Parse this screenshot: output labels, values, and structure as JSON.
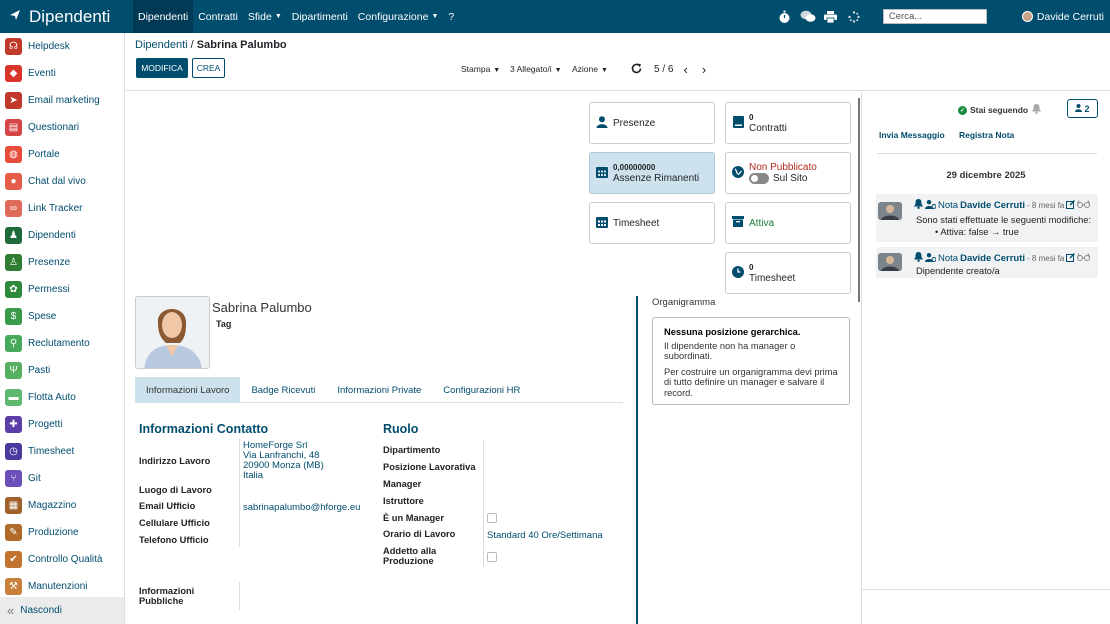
{
  "topbar": {
    "app_title": "Dipendenti",
    "menu": [
      {
        "label": "Dipendenti",
        "active": true
      },
      {
        "label": "Contratti",
        "active": false
      },
      {
        "label": "Sfide",
        "active": false,
        "caret": true
      },
      {
        "label": "Dipartimenti",
        "active": false
      },
      {
        "label": "Configurazione",
        "active": false,
        "caret": true
      },
      {
        "label": "?",
        "active": false
      }
    ],
    "search_placeholder": "Cerca...",
    "user_name": "Davide Cerruti"
  },
  "sidebar": {
    "items": [
      {
        "label": "Helpdesk",
        "color": "#c0392b",
        "icon": "headset-icon"
      },
      {
        "label": "Eventi",
        "color": "#d9352b",
        "icon": "ticket-icon"
      },
      {
        "label": "Email marketing",
        "color": "#c0392b",
        "icon": "paper-plane-icon"
      },
      {
        "label": "Questionari",
        "color": "#d64545",
        "icon": "clipboard-icon"
      },
      {
        "label": "Portale",
        "color": "#e74c3c",
        "icon": "globe-icon"
      },
      {
        "label": "Chat dal vivo",
        "color": "#e85d4a",
        "icon": "chat-icon"
      },
      {
        "label": "Link Tracker",
        "color": "#e06a5a",
        "icon": "link-icon"
      },
      {
        "label": "Dipendenti",
        "color": "#1e6a3a",
        "icon": "users-icon"
      },
      {
        "label": "Presenze",
        "color": "#2e7d32",
        "icon": "user-check-icon"
      },
      {
        "label": "Permessi",
        "color": "#2e8b3e",
        "icon": "leaf-icon"
      },
      {
        "label": "Spese",
        "color": "#3a9a4a",
        "icon": "dollar-icon"
      },
      {
        "label": "Reclutamento",
        "color": "#46a85a",
        "icon": "search-user-icon"
      },
      {
        "label": "Pasti",
        "color": "#55b060",
        "icon": "utensils-icon"
      },
      {
        "label": "Flotta Auto",
        "color": "#5fb870",
        "icon": "car-icon"
      },
      {
        "label": "Progetti",
        "color": "#5b3ea8",
        "icon": "puzzle-icon"
      },
      {
        "label": "Timesheet",
        "color": "#4a3aa0",
        "icon": "clock-icon"
      },
      {
        "label": "Git",
        "color": "#6a4fb8",
        "icon": "git-icon"
      },
      {
        "label": "Magazzino",
        "color": "#a0612a",
        "icon": "cubes-icon"
      },
      {
        "label": "Produzione",
        "color": "#b06a2a",
        "icon": "wrench-icon"
      },
      {
        "label": "Controllo Qualità",
        "color": "#c07430",
        "icon": "check-icon"
      },
      {
        "label": "Manutenzioni",
        "color": "#c8803a",
        "icon": "hammer-icon"
      }
    ],
    "hide_label": "Nascondi"
  },
  "breadcrumb": {
    "parent": "Dipendenti",
    "separator": "/",
    "current": "Sabrina Palumbo"
  },
  "toolbar": {
    "edit_label": "MODIFICA",
    "create_label": "CREA",
    "print_label": "Stampa",
    "attachments_label": "3 Allegato/i",
    "action_label": "Azione",
    "pager": "5 / 6"
  },
  "smart_buttons": {
    "presenze": "Presenze",
    "contratti_count": "0",
    "contratti": "Contratti",
    "assenze_value": "0,00000000",
    "assenze": "Assenze Rimanenti",
    "pubblicato": "Non Pubblicato",
    "sul_sito": "Sul Sito",
    "timesheet": "Timesheet",
    "attiva": "Attiva",
    "timesheet_count": "0",
    "timesheet2": "Timesheet"
  },
  "employee": {
    "name": "Sabrina Palumbo",
    "tag_label": "Tag"
  },
  "tabs": [
    {
      "label": "Informazioni Lavoro",
      "active": true
    },
    {
      "label": "Badge Ricevuti",
      "active": false
    },
    {
      "label": "Informazioni Private",
      "active": false
    },
    {
      "label": "Configurazioni HR",
      "active": false
    }
  ],
  "contact": {
    "title": "Informazioni Contatto",
    "work_address_label": "Indirizzo Lavoro",
    "address_lines": [
      "HomeForge Srl",
      "Via Lanfranchi, 48",
      "20900 Monza (MB)",
      "Italia"
    ],
    "work_location_label": "Luogo di Lavoro",
    "work_email_label": "Email Ufficio",
    "work_email": "sabrinapalumbo@hforge.eu",
    "mobile_label": "Cellulare Ufficio",
    "phone_label": "Telefono Ufficio",
    "public_info_label_1": "Informazioni",
    "public_info_label_2": "Pubbliche"
  },
  "role": {
    "title": "Ruolo",
    "department_label": "Dipartimento",
    "position_label": "Posizione Lavorativa",
    "manager_label": "Manager",
    "coach_label": "Istruttore",
    "is_manager_label": "È un Manager",
    "hours_label": "Orario di Lavoro",
    "hours_value": "Standard 40 Ore/Settimana",
    "production_label_1": "Addetto alla",
    "production_label_2": "Produzione"
  },
  "org": {
    "label": "Organigramma",
    "box_title": "Nessuna posizione gerarchica.",
    "box_text_1": "Il dipendente non ha manager o subordinati.",
    "box_text_2": "Per costruire un organigramma devi prima di tutto definire un manager e salvare il record."
  },
  "chatter": {
    "following": "Stai seguendo",
    "followers": "2",
    "send_message": "Invia Messaggio",
    "log_note": "Registra Nota",
    "date": "29 dicembre 2025",
    "messages": [
      {
        "type": "Nota",
        "author": "Davide Cerruti",
        "time": "- 8 mesi fa",
        "body": "Sono stati effettuate le seguenti modifiche:",
        "change": "Attiva: false → true"
      },
      {
        "type": "Nota",
        "author": "Davide Cerruti",
        "time": "- 8 mesi fa",
        "body": "Dipendente creato/a"
      }
    ]
  }
}
